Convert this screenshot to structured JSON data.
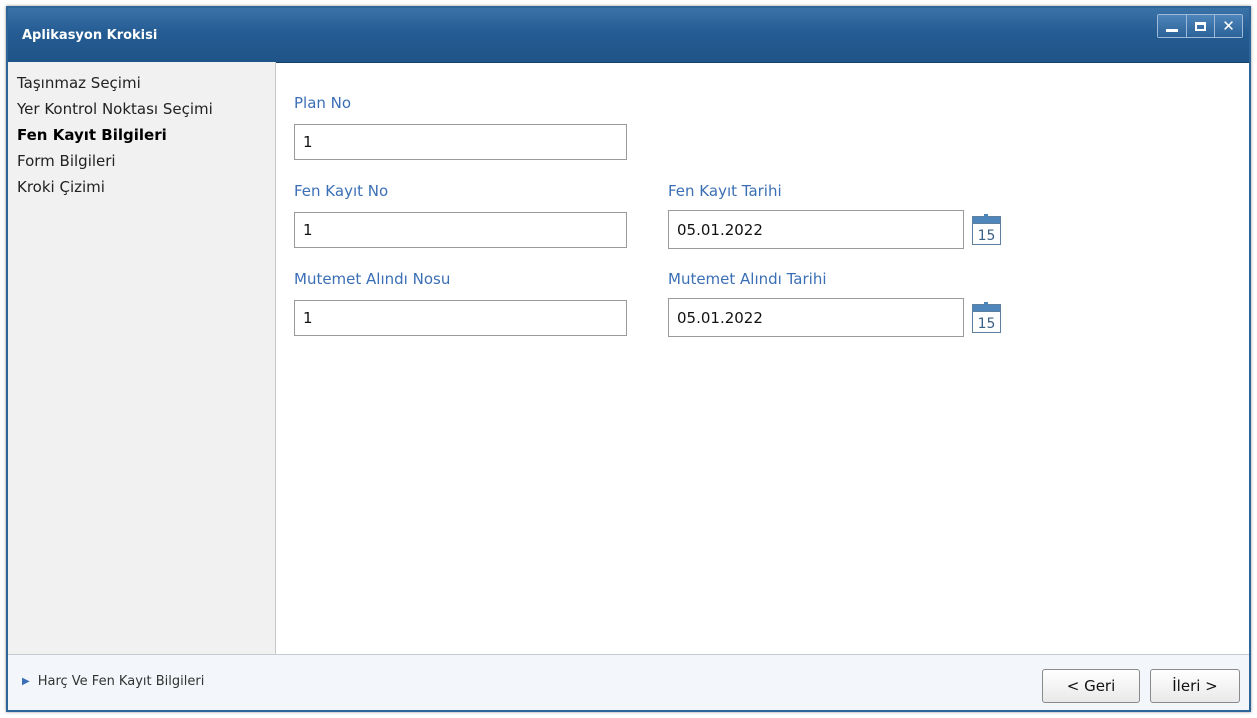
{
  "window": {
    "title": "Aplikasyon Krokisi",
    "controls": {
      "minimize": "minimize",
      "maximize": "maximize",
      "close": "✕"
    }
  },
  "sidebar": {
    "items": [
      {
        "label": "Taşınmaz Seçimi",
        "active": false
      },
      {
        "label": "Yer Kontrol Noktası Seçimi",
        "active": false
      },
      {
        "label": "Fen Kayıt Bilgileri",
        "active": true
      },
      {
        "label": "Form Bilgileri",
        "active": false
      },
      {
        "label": "Kroki Çizimi",
        "active": false
      }
    ]
  },
  "form": {
    "plan_no": {
      "label": "Plan No",
      "value": "1"
    },
    "fen_kayit_no": {
      "label": "Fen Kayıt No",
      "value": "1"
    },
    "fen_kayit_tarihi": {
      "label": "Fen Kayıt Tarihi",
      "value": "05.01.2022"
    },
    "mutemet_alindi_nosu": {
      "label": "Mutemet Alındı Nosu",
      "value": "1"
    },
    "mutemet_alindi_tarihi": {
      "label": "Mutemet Alındı Tarihi",
      "value": "05.01.2022"
    },
    "calendar_icon_day": "15"
  },
  "footer": {
    "section_label": "Harç Ve Fen Kayıt Bilgileri",
    "back_label": "< Geri",
    "next_label": "İleri >"
  },
  "colors": {
    "titlebar": "#245c93",
    "label_blue": "#3b6fb5"
  },
  "icons": [
    "chevron-right-icon",
    "calendar-icon",
    "minimize-icon",
    "maximize-icon",
    "close-icon"
  ]
}
